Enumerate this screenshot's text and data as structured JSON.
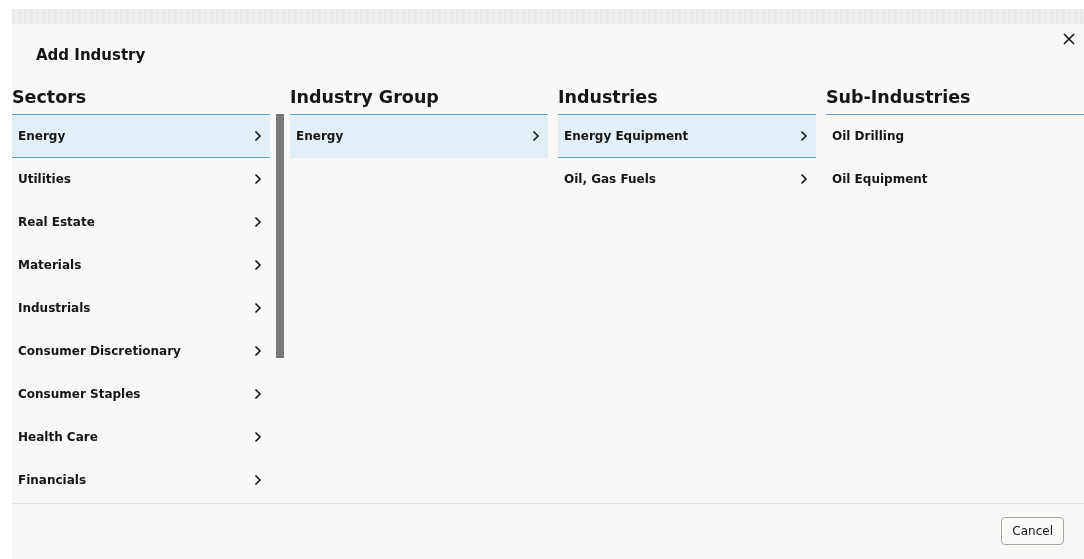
{
  "dialog": {
    "title": "Add Industry"
  },
  "columns": [
    {
      "heading": "Sectors",
      "items": [
        {
          "label": "Energy",
          "kind": "branch",
          "selected": true
        },
        {
          "label": "Utilities",
          "kind": "branch",
          "selected": false
        },
        {
          "label": "Real Estate",
          "kind": "branch",
          "selected": false
        },
        {
          "label": "Materials",
          "kind": "branch",
          "selected": false
        },
        {
          "label": "Industrials",
          "kind": "branch",
          "selected": false
        },
        {
          "label": "Consumer Discretionary",
          "kind": "branch",
          "selected": false
        },
        {
          "label": "Consumer Staples",
          "kind": "branch",
          "selected": false
        },
        {
          "label": "Health Care",
          "kind": "branch",
          "selected": false
        },
        {
          "label": "Financials",
          "kind": "branch",
          "selected": false
        }
      ]
    },
    {
      "heading": "Industry Group",
      "items": [
        {
          "label": "Energy",
          "kind": "branch",
          "selected": true
        }
      ]
    },
    {
      "heading": "Industries",
      "items": [
        {
          "label": "Energy Equipment",
          "kind": "branch",
          "selected": true
        },
        {
          "label": "Oil, Gas Fuels",
          "kind": "branch",
          "selected": false
        }
      ]
    },
    {
      "heading": "Sub-Industries",
      "items": [
        {
          "label": "Oil Drilling",
          "kind": "leaf",
          "selected": false
        },
        {
          "label": "Oil Equipment",
          "kind": "leaf",
          "selected": false
        }
      ]
    }
  ],
  "buttons": [
    {
      "label": "Cancel"
    }
  ]
}
